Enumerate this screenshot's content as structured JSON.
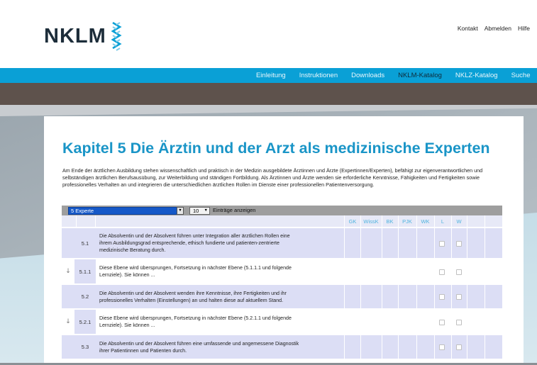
{
  "header": {
    "logo_text": "NKLM",
    "links": [
      "Kontakt",
      "Abmelden",
      "Hilfe"
    ]
  },
  "nav": {
    "items": [
      {
        "label": "Einleitung",
        "active": false
      },
      {
        "label": "Instruktionen",
        "active": false
      },
      {
        "label": "Downloads",
        "active": false
      },
      {
        "label": "NKLM-Katalog",
        "active": true
      },
      {
        "label": "NKLZ-Katalog",
        "active": false
      },
      {
        "label": "Suche",
        "active": false
      }
    ]
  },
  "colors": {
    "accent": "#0aa0d6",
    "title": "#1a95c7",
    "row_highlight": "#dcdef5",
    "select_blue": "#1558c8"
  },
  "page": {
    "title": "Kapitel 5 Die Ärztin und der Arzt als medizinische Experten",
    "intro": "Am Ende der ärztlichen Ausbildung stehen wissenschaftlich und praktisch in der Medizin ausgebildete Ärztinnen und Ärzte (Expertinnen/Experten), befähigt zur eigenverantwortlichen und selbständigen ärztlichen Berufsausübung, zur Weiterbildung und ständigen Fortbildung. Als Ärztinnen und Ärzte wenden sie erforderliche Kenntnisse, Fähigkeiten und Fertigkeiten sowie professionelles Verhalten an und integrieren die unterschiedlichen ärztlichen Rollen im Dienste einer professionellen Patientenversorgung."
  },
  "toolbar": {
    "experte_select": "5 Experte",
    "count_select": "10",
    "entries_label": "Einträge anzeigen"
  },
  "table": {
    "columns": [
      "GK",
      "WissK",
      "BK",
      "PJK",
      "WK",
      "L",
      "W"
    ],
    "rows": [
      {
        "num": "5.1",
        "level": 1,
        "expand": false,
        "lines": [
          "Die Absolventin und der Absolvent führen unter Integration aller ärztlichen Rollen eine",
          "ihrem Ausbildungsgrad entsprechende, ethisch fundierte und patienten-zentrierte",
          "medizinische Beratung durch."
        ]
      },
      {
        "num": "5.1.1",
        "level": 2,
        "expand": true,
        "lines": [
          "Diese Ebene wird übersprungen, Fortsetzung in nächster Ebene (5.1.1.1 und folgende",
          "Lernziele). Sie können ..."
        ]
      },
      {
        "num": "5.2",
        "level": 1,
        "expand": false,
        "lines": [
          "Die Absolventin und der Absolvent wenden ihre Kenntnisse, ihre Fertigkeiten und ihr",
          "professionelles Verhalten (Einstellungen) an und halten diese auf aktuellem Stand."
        ]
      },
      {
        "num": "5.2.1",
        "level": 2,
        "expand": true,
        "lines": [
          "Diese Ebene wird übersprungen, Fortsetzung in nächster Ebene (5.2.1.1 und folgende",
          "Lernziele). Sie können ..."
        ]
      },
      {
        "num": "5.3",
        "level": 1,
        "expand": false,
        "lines": [
          "Die Absolventin und der Absolvent führen eine umfassende und angemessene Diagnostik",
          "ihrer Patientinnen und Patienten durch."
        ]
      }
    ]
  }
}
